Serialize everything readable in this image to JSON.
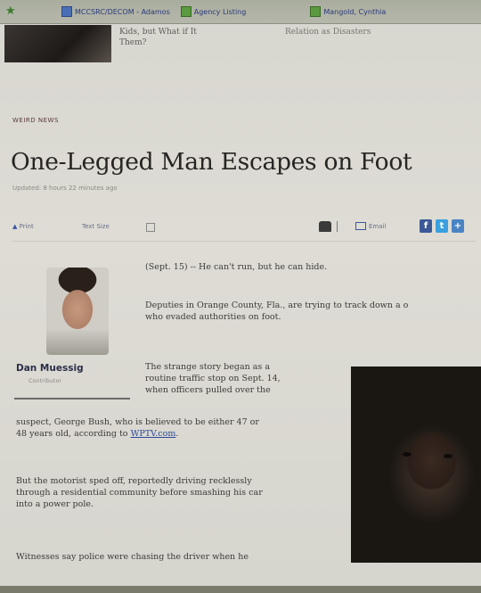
{
  "bookmarks": [
    {
      "label": "MCCSRC/DECOM - Adamos",
      "icon": "page-icon"
    },
    {
      "label": "Agency Listing",
      "icon": "page-icon"
    },
    {
      "label": "Mangold, Cynthia",
      "icon": "page-icon"
    }
  ],
  "top_story": {
    "line1": "Kids, but What if It",
    "line2": "Them?",
    "right_text": "Relation as Disasters"
  },
  "article": {
    "section": "WEIRD NEWS",
    "headline": "One-Legged Man Escapes on Foot",
    "updated": "Updated: 8 hours 22 minutes ago",
    "tools": {
      "print_label": "Print",
      "text_size_label": "Text Size",
      "email_label": "Email"
    },
    "author": {
      "name": "Dan Muessig",
      "role": "Contributor"
    },
    "paragraphs": {
      "p1": "(Sept. 15) -- He can't run, but he can hide.",
      "p2a": "Deputies in Orange County, Fla., are trying to track down a o",
      "p2b": "who evaded authorities on foot.",
      "p3a": "The strange story began as a",
      "p3b": "routine traffic stop on Sept. 14,",
      "p3c": "when officers pulled over the",
      "p3d": "suspect, George Bush, who is believed to be either 47 or",
      "p3e": "48 years old, according to",
      "p3_link": "WPTV.com",
      "p4a": "But the motorist sped off, reportedly driving recklessly",
      "p4b": "through a residential community before smashing his car",
      "p4c": "into a power pole.",
      "p5a": "Witnesses say police were chasing the driver when he"
    }
  },
  "colors": {
    "headline": "#272522",
    "link": "#2c4a9a",
    "facebook": "#3b5998",
    "twitter": "#3aa0e0"
  }
}
